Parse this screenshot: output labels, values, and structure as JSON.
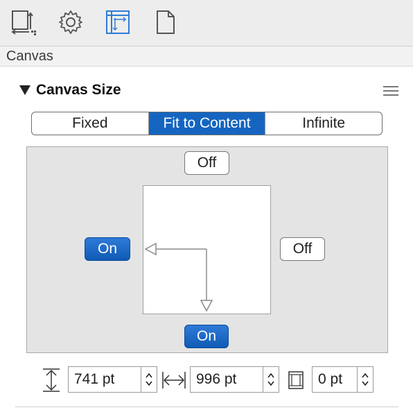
{
  "section": {
    "title": "Canvas"
  },
  "panel": {
    "title": "Canvas Size"
  },
  "segments": [
    {
      "label": "Fixed",
      "active": false
    },
    {
      "label": "Fit to Content",
      "active": true
    },
    {
      "label": "Infinite",
      "active": false
    }
  ],
  "edges": {
    "top": "Off",
    "left": "On",
    "right": "Off",
    "bottom": "On"
  },
  "fields": {
    "height": "741 pt",
    "width": "996 pt",
    "margin": "0 pt"
  },
  "icons": {
    "toolbar": [
      "canvas-resize-icon",
      "gear-icon",
      "canvas-layout-icon",
      "document-icon"
    ],
    "active_toolbar": "canvas-layout-icon"
  },
  "colors": {
    "accent": "#1565c0",
    "toolbar_active": "#2e7cd6"
  }
}
